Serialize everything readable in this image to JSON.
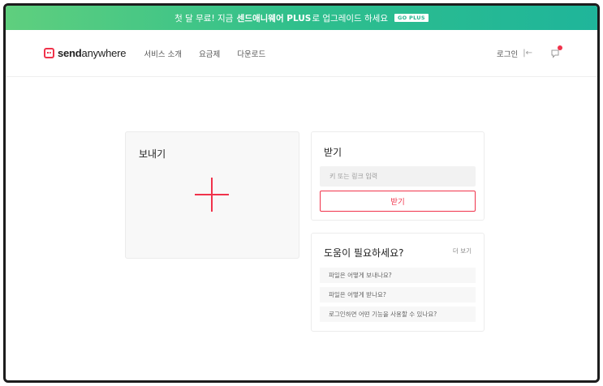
{
  "banner": {
    "text_before": "첫 달 무료! 지금",
    "highlight": "센드애니웨어 PLUS",
    "text_after": "로 업그레이드 하세요",
    "code": "GO PLUS"
  },
  "header": {
    "logo_bold": "send",
    "logo_rest": "anywhere",
    "nav": [
      "서비스 소개",
      "요금제",
      "다운로드"
    ],
    "login_label": "로그인",
    "login_icon_glyph": "|←"
  },
  "send": {
    "title": "보내기",
    "icon": "plus-icon"
  },
  "receive": {
    "title": "받기",
    "input_placeholder": "키 또는 링크 입력",
    "button_label": "받기"
  },
  "help": {
    "title": "도움이 필요하세요?",
    "more_label": "더 보기",
    "items": [
      "파일은 어떻게 보내나요?",
      "파일은 어떻게 받나요?",
      "로그인하면 어떤 기능을 사용할 수 있나요?"
    ]
  },
  "colors": {
    "accent": "#f0334b",
    "banner_start": "#5fcf7e",
    "banner_end": "#1fb59a"
  }
}
